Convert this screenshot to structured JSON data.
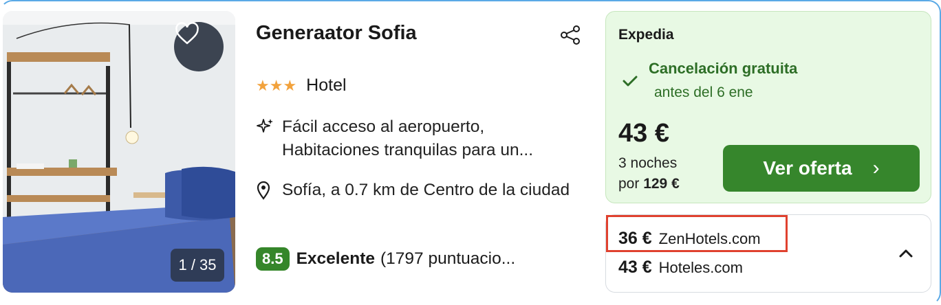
{
  "hotel": {
    "name": "Generaator Sofia",
    "stars_glyph": "★★★",
    "type": "Hotel",
    "features": "Fácil acceso al aeropuerto, Habitaciones tranquilas para un...",
    "location": "Sofía, a 0.7 km de Centro de la ciudad",
    "score": "8.5",
    "rating_label": "Excelente",
    "rating_count": "(1797 puntuacio..."
  },
  "gallery": {
    "counter": "1 / 35"
  },
  "offer": {
    "provider": "Expedia",
    "cancel_title": "Cancelación gratuita",
    "cancel_sub": "antes del 6 ene",
    "price": "43 €",
    "nights_line": "3 noches",
    "nights_prefix": "por",
    "total": "129 €",
    "cta_label": "Ver oferta",
    "cta_chevron": "›"
  },
  "other_offers": [
    {
      "price": "36 €",
      "provider": "ZenHotels.com",
      "highlighted": true
    },
    {
      "price": "43 €",
      "provider": "Hoteles.com",
      "highlighted": false
    }
  ],
  "colors": {
    "accent_green": "#36862c",
    "offer_bg": "#e8f9e4",
    "stars": "#f2a23c",
    "highlight_border": "#e0412f"
  },
  "icons": {
    "favorite": "heart-icon",
    "share": "share-icon",
    "feature": "sparkle-icon",
    "location": "map-pin-icon",
    "check": "check-icon",
    "collapse": "chevron-up-icon"
  }
}
